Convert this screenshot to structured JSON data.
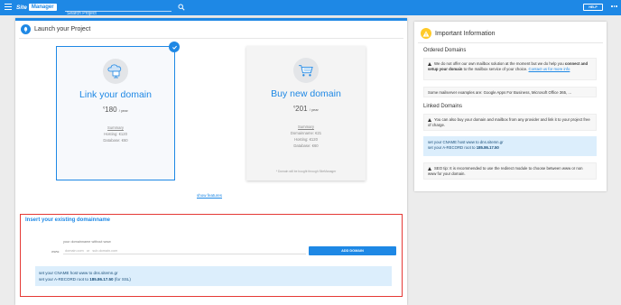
{
  "topbar": {
    "logo_prefix": "Site",
    "logo_name": "Manager",
    "search_placeholder": "Search Project",
    "help_label": "HELP",
    "colors": {
      "primary": "#1e88e5"
    }
  },
  "launch": {
    "title": "Launch your Project"
  },
  "cards": [
    {
      "title": "Link your domain",
      "currency": "€",
      "price": "180",
      "period": "/ year",
      "summary_label": "Summary",
      "lines": [
        "Hosting: €120",
        "Database: €60"
      ],
      "selected": true
    },
    {
      "title": "Buy new domain",
      "currency": "€",
      "price": "201",
      "period": "/ year",
      "summary_label": "Summary",
      "lines": [
        "Domainname: €21",
        "Hosting: €120",
        "Database: €60"
      ],
      "note": "* Domain will be bought through SiteManager",
      "selected": false
    }
  ],
  "show_features_label": "show features",
  "insert": {
    "title": "Insert your existing domainname",
    "field_label": "your domainname without www",
    "www_prefix": "www.",
    "input_placeholder": "domain.com   or   sub.domain.com",
    "button_label": "ADD DOMAIN",
    "info_line1": "set your CNAME host www to dns.sitemn.gr",
    "info_line2_prefix": "set your A-RECORD root to ",
    "info_line2_ip": "185.86.17.50",
    "info_line2_suffix": " (for SSL)"
  },
  "side": {
    "title": "Important Information",
    "ordered_heading": "Ordered Domains",
    "ordered_warning_prefix": "We do not offer our own mailbox solution at the moment but we do help you ",
    "ordered_warning_bold": "connect and setup your domain",
    "ordered_warning_mid": " to the mailbox service of your choice. ",
    "ordered_warning_link": "Contact us for more info",
    "ordered_examples": "Some mailserver examples are: Google Apps For Business, Microsoft Office 365, ...",
    "linked_heading": "Linked Domains",
    "linked_warning": "You can also buy your domain and mailbox from any provider and link it to your project free of charge.",
    "linked_dns_line1": "set your CNAME host www to dns.sitemn.gr",
    "linked_dns_line2_prefix": "set your A-RECORD root to ",
    "linked_dns_ip": "185.86.17.50",
    "seo_prefix": "SEO tip: ",
    "seo_text": "It is recommended to use the redirect module to choose between www or non www for your domain."
  }
}
